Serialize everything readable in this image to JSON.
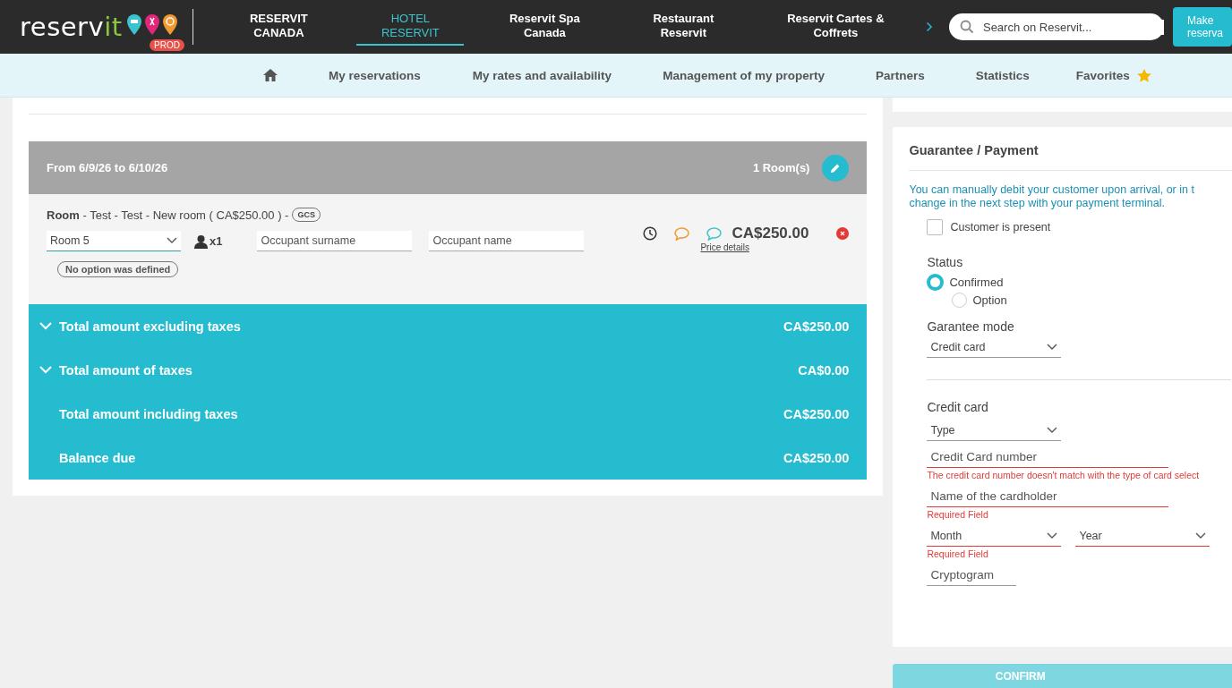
{
  "header": {
    "logo": {
      "text": "reserv",
      "accent": "it",
      "badge": "PROD"
    },
    "nav": [
      {
        "lines": [
          "RESERVIT",
          "CANADA"
        ],
        "selected": false
      },
      {
        "lines": [
          "HOTEL",
          "RESERVIT"
        ],
        "selected": true
      },
      {
        "lines": [
          "Reservit Spa",
          "Canada"
        ],
        "selected": false
      },
      {
        "lines": [
          "Restaurant",
          "Reservit"
        ],
        "selected": false
      },
      {
        "lines": [
          "Reservit Cartes &",
          "Coffrets"
        ],
        "selected": false
      }
    ],
    "search": {
      "placeholder": "Search on Reservit..."
    },
    "make_button": [
      "Make",
      "reserva"
    ]
  },
  "subnav": [
    {
      "kind": "home"
    },
    {
      "kind": "link",
      "label": "My reservations"
    },
    {
      "kind": "link",
      "label": "My rates and availability"
    },
    {
      "kind": "link",
      "label": "Management of my property"
    },
    {
      "kind": "link",
      "label": "Partners"
    },
    {
      "kind": "link",
      "label": "Statistics"
    },
    {
      "kind": "favorites",
      "label": "Favorites"
    }
  ],
  "stay": {
    "dates": "From 6/9/26 to 6/10/26",
    "rooms": "1 Room(s)"
  },
  "room": {
    "title": "Room",
    "description": "- Test - Test - New room ( CA$250.00 ) -",
    "code": "GCS",
    "room_select": "Room 5",
    "occupancy": "x1",
    "surname_placeholder": "Occupant surname",
    "name_placeholder": "Occupant name",
    "option_tag": "No option was defined",
    "price": "CA$250.00",
    "price_link": "Price details"
  },
  "totals": [
    {
      "label": "Total amount excluding taxes",
      "amount": "CA$250.00",
      "expandable": true
    },
    {
      "label": "Total amount of taxes",
      "amount": "CA$0.00",
      "expandable": true
    },
    {
      "label": "Total amount including taxes",
      "amount": "CA$250.00",
      "expandable": false
    },
    {
      "label": "Balance due",
      "amount": "CA$250.00",
      "expandable": false
    }
  ],
  "payment": {
    "title": "Guarantee / Payment",
    "info_lines": [
      "You can manually debit your customer upon arrival, or in t",
      "change in the next step with your payment terminal."
    ],
    "customer_present": {
      "label": "Customer is present",
      "checked": false
    },
    "status": {
      "label": "Status",
      "options": [
        {
          "label": "Confirmed",
          "selected": true
        },
        {
          "label": "Option",
          "selected": false
        }
      ]
    },
    "guarantee_mode": {
      "label": "Garantee mode",
      "value": "Credit card"
    },
    "credit_card": {
      "label": "Credit card",
      "rows": [
        {
          "fields": [
            {
              "kind": "select",
              "placeholder": "Type",
              "invalid": false
            }
          ]
        },
        {
          "fields": [
            {
              "kind": "input",
              "placeholder": "Credit Card number",
              "invalid": true
            }
          ],
          "error": "The credit card number doesn't match with the type of card select"
        },
        {
          "fields": [
            {
              "kind": "input",
              "placeholder": "Name of the cardholder",
              "invalid": true
            }
          ],
          "error": "Required Field"
        },
        {
          "fields": [
            {
              "kind": "select",
              "placeholder": "Month",
              "invalid": true
            },
            {
              "kind": "select",
              "placeholder": "Year",
              "invalid": true
            }
          ],
          "error": "Required Field"
        },
        {
          "fields": [
            {
              "kind": "short_input",
              "placeholder": "Cryptogram",
              "invalid": false
            }
          ]
        }
      ]
    }
  },
  "confirm": {
    "label": "CONFIRM",
    "disabled": true
  }
}
